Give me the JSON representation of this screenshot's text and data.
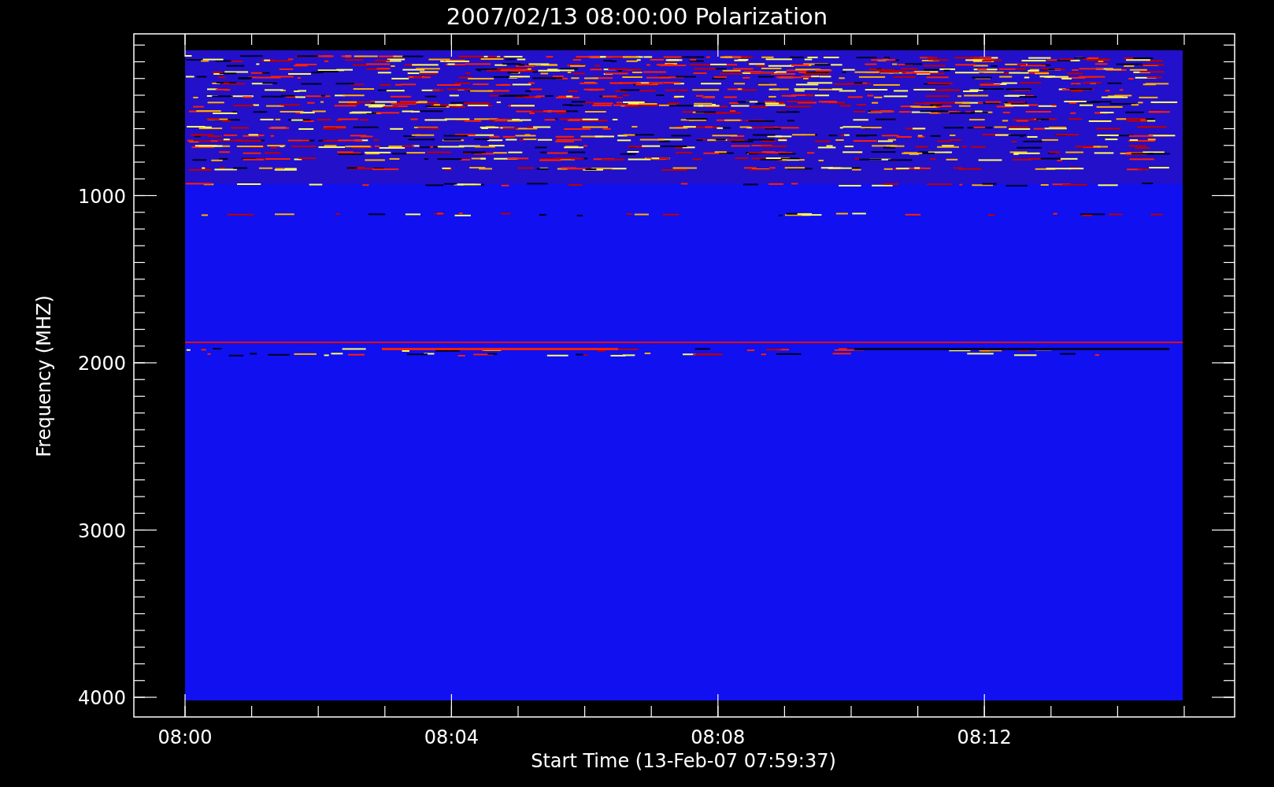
{
  "title": "2007/02/13 08:00:00 Polarization",
  "y_axis": {
    "label": "Frequency (MHZ)",
    "ticks": [
      "1000",
      "2000",
      "3000",
      "4000"
    ]
  },
  "x_axis": {
    "label": "Start Time (13-Feb-07 07:59:37)",
    "ticks": [
      "08:00",
      "08:04",
      "08:08",
      "08:12"
    ]
  }
}
